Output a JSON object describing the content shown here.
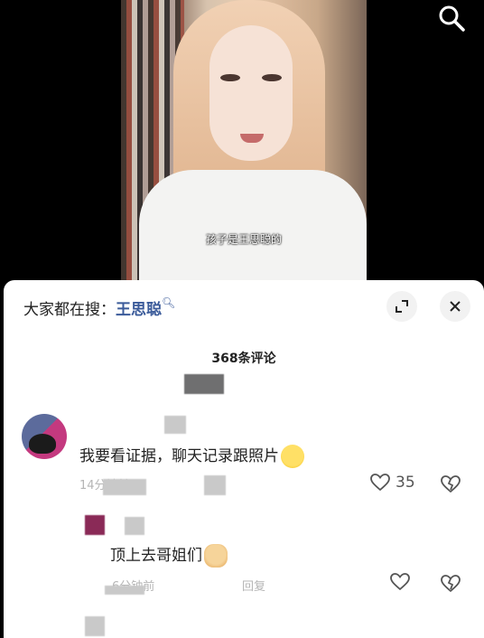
{
  "video": {
    "subtitle": "孩子是王思聪的"
  },
  "hot_search": {
    "prefix": "大家都在搜：",
    "keyword": "王思聪"
  },
  "comments_header": {
    "count_label": "368条评论"
  },
  "comments": [
    {
      "text": "我要看证据，聊天记录跟照片",
      "emoji": "crying-laughing-icon",
      "meta": "14分钟前",
      "likes": "35"
    },
    {
      "text": "顶上去哥姐们",
      "emoji": "doge-icon",
      "meta": "6分钟前",
      "reply_label": "回复",
      "likes": ""
    }
  ],
  "colors": {
    "keyword": "#3b5b9a",
    "sheet_bg": "#ffffff",
    "video_bg": "#000000"
  }
}
